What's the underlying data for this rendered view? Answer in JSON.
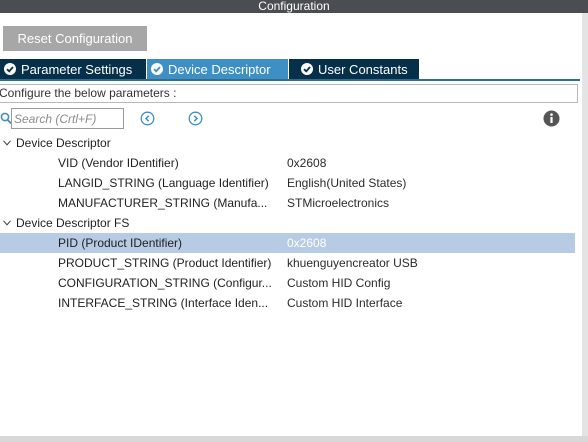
{
  "window": {
    "title": "Configuration"
  },
  "toolbar": {
    "reset_label": "Reset Configuration"
  },
  "tabs": [
    {
      "label": "Parameter Settings",
      "active": false
    },
    {
      "label": "Device Descriptor",
      "active": true
    },
    {
      "label": "User Constants",
      "active": false
    }
  ],
  "configure_text": "Configure the below parameters :",
  "search": {
    "placeholder": "Search (Crtl+F)",
    "value": ""
  },
  "groups": [
    {
      "label": "Device Descriptor",
      "rows": [
        {
          "name": "VID (Vendor IDentifier)",
          "value": "0x2608"
        },
        {
          "name": "LANGID_STRING (Language Identifier)",
          "value": "English(United States)"
        },
        {
          "name": "MANUFACTURER_STRING (Manufa...",
          "value": "STMicroelectronics"
        }
      ]
    },
    {
      "label": "Device Descriptor FS",
      "rows": [
        {
          "name": "PID (Product IDentifier)",
          "value": "0x2608",
          "selected": true
        },
        {
          "name": "PRODUCT_STRING (Product Identifier)",
          "value": "khuenguyencreator USB"
        },
        {
          "name": "CONFIGURATION_STRING (Configur...",
          "value": "Custom HID Config"
        },
        {
          "name": "INTERFACE_STRING (Interface Iden...",
          "value": "Custom HID Interface"
        }
      ]
    }
  ],
  "colors": {
    "accent": "#3d8fc4",
    "tab_dark": "#06304a",
    "selection": "#b7cbe5",
    "nav_icon": "#3d8fc4"
  }
}
